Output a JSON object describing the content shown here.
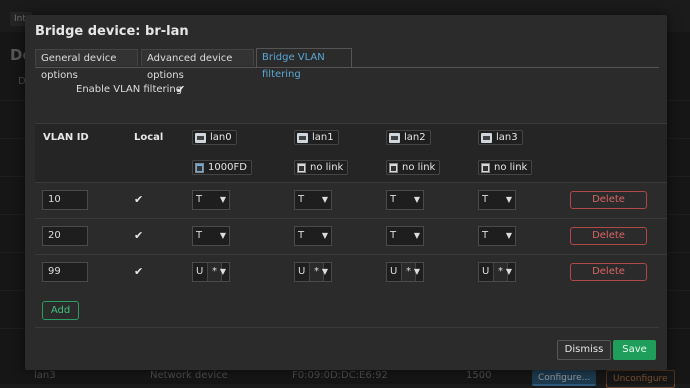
{
  "background": {
    "tab_label": "Int",
    "heading": "De",
    "column_initial": "D",
    "bottom_row": {
      "name": "lan3",
      "type": "Network device",
      "mac": "F0:09:0D:DC:E6:92",
      "mtu": "1500",
      "configure_label": "Configure...",
      "unconfigure_label": "Unconfigure"
    }
  },
  "modal": {
    "title": "Bridge device: br-lan",
    "tabs": [
      {
        "label": "General device options",
        "active": false
      },
      {
        "label": "Advanced device options",
        "active": false
      },
      {
        "label": "Bridge VLAN filtering",
        "active": true
      }
    ],
    "enable_vlan_filtering": {
      "label": "Enable VLAN filtering",
      "checked": true
    },
    "table": {
      "headers": {
        "vlan_id": "VLAN ID",
        "local": "Local"
      },
      "ports": [
        {
          "name": "lan0",
          "status": "1000FD",
          "icon": "ethernet-port-icon"
        },
        {
          "name": "lan1",
          "status": "no link",
          "icon": "ethernet-port-icon"
        },
        {
          "name": "lan2",
          "status": "no link",
          "icon": "ethernet-port-icon"
        },
        {
          "name": "lan3",
          "status": "no link",
          "icon": "ethernet-port-icon"
        }
      ],
      "rows": [
        {
          "vlan_id": "10",
          "local": true,
          "ports": [
            {
              "mode": "T",
              "flag": ""
            },
            {
              "mode": "T",
              "flag": ""
            },
            {
              "mode": "T",
              "flag": ""
            },
            {
              "mode": "T",
              "flag": ""
            }
          ],
          "delete_label": "Delete"
        },
        {
          "vlan_id": "20",
          "local": true,
          "ports": [
            {
              "mode": "T",
              "flag": ""
            },
            {
              "mode": "T",
              "flag": ""
            },
            {
              "mode": "T",
              "flag": ""
            },
            {
              "mode": "T",
              "flag": ""
            }
          ],
          "delete_label": "Delete"
        },
        {
          "vlan_id": "99",
          "local": true,
          "ports": [
            {
              "mode": "U",
              "flag": "*"
            },
            {
              "mode": "U",
              "flag": "*"
            },
            {
              "mode": "U",
              "flag": "*"
            },
            {
              "mode": "U",
              "flag": "*"
            }
          ],
          "delete_label": "Delete"
        }
      ]
    },
    "add_label": "Add",
    "dismiss_label": "Dismiss",
    "save_label": "Save"
  },
  "colors": {
    "active_tab": "#59a6d4",
    "delete": "#d96464",
    "add": "#3fc27e",
    "save_bg": "#1f9d5a"
  }
}
